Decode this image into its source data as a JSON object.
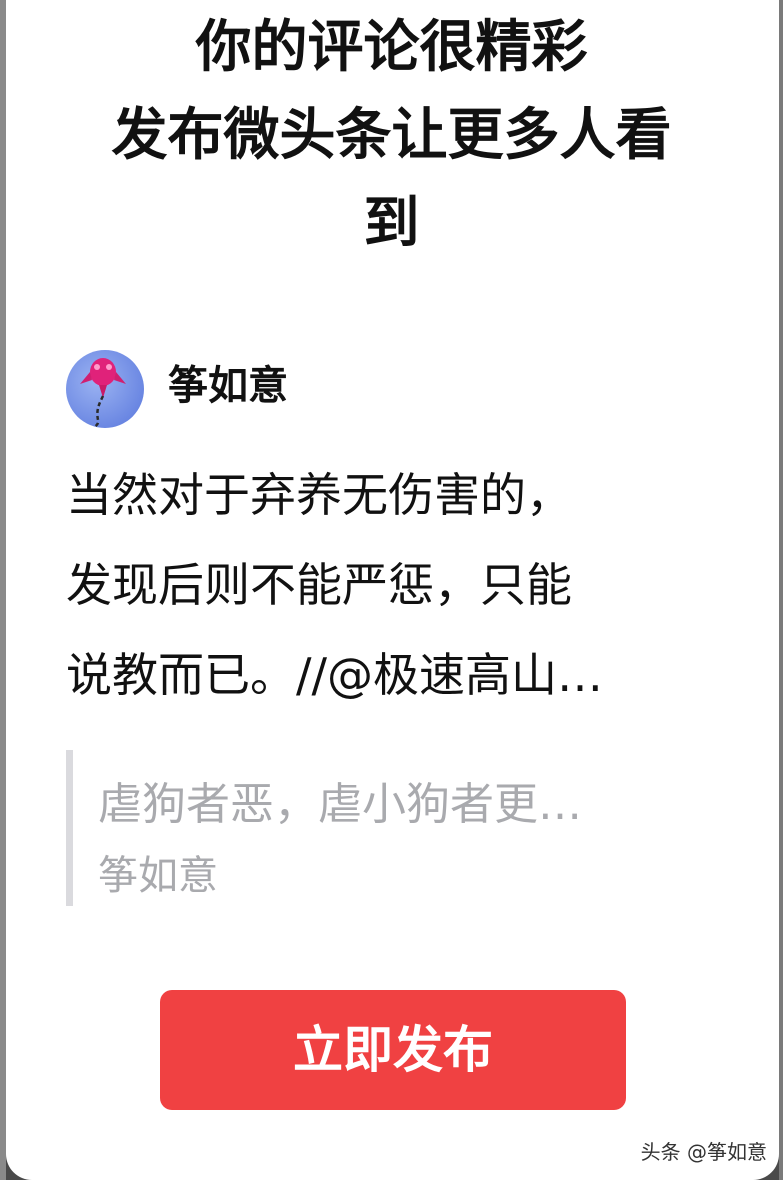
{
  "colors": {
    "primary_text": "#111111",
    "quote_text": "#a9aaae",
    "publish_button": "#f04142",
    "avatar_bg": "#6f8ee6"
  },
  "dialog": {
    "title_lines": [
      "你的评论很精彩",
      "发布微头条让更多人看",
      "到"
    ]
  },
  "author": {
    "name": "筝如意",
    "avatar_icon": "pink-kite-avatar-icon"
  },
  "comment": {
    "lines": [
      "当然对于弃养无伤害的，",
      "发现后则不能严惩，只能",
      "说教而已。//@极速高山…"
    ]
  },
  "quote": {
    "text": "虐狗者恶，虐小狗者更…",
    "author": "筝如意"
  },
  "actions": {
    "publish_label": "立即发布"
  },
  "watermark": {
    "text": "头条 @筝如意"
  }
}
